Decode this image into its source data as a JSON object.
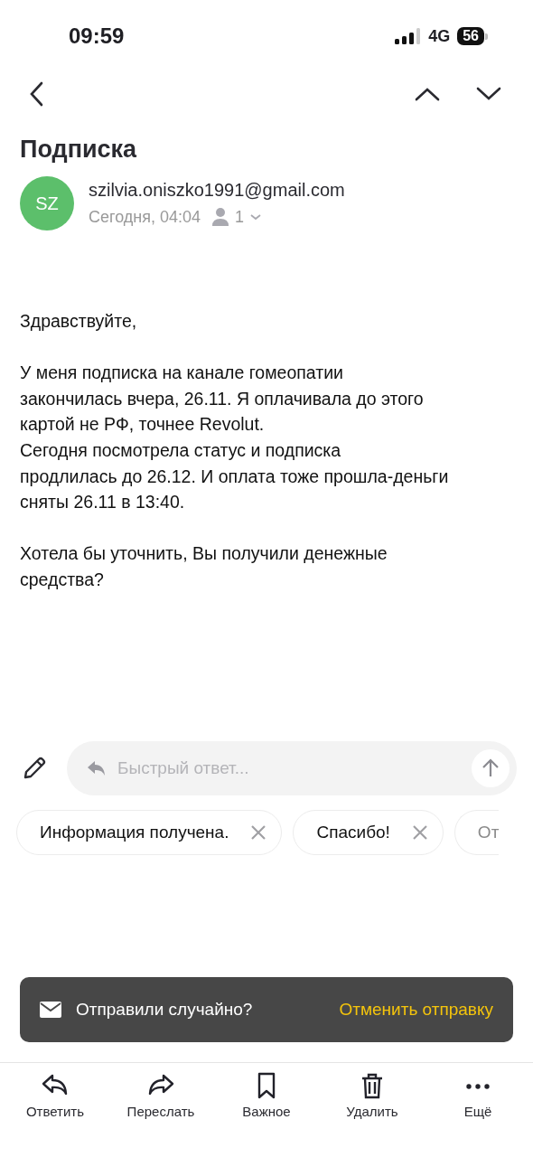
{
  "status_bar": {
    "time": "09:59",
    "network": "4G",
    "battery": "56"
  },
  "message": {
    "subject": "Подписка",
    "sender_initials": "SZ",
    "sender": "szilvia.oniszko1991@gmail.com",
    "date": "Сегодня, 04:04",
    "recipients_count": "1",
    "body": [
      [
        "Здравствуйте,"
      ],
      [
        "У меня подписка на канале гомеопатии",
        "закончилась вчера, 26.11. Я оплачивала до этого",
        "картой не РФ, точнее Revolut.",
        "Сегодня посмотрела статус и  подписка",
        "продлилась до 26.12. И оплата тоже прошла-деньги",
        "сняты 26.11 в 13:40."
      ],
      [
        "Хотела бы уточнить, Вы получили денежные",
        "средства?"
      ]
    ]
  },
  "quick_reply": {
    "placeholder": "Быстрый ответ..."
  },
  "suggestions": [
    {
      "label": "Информация получена."
    },
    {
      "label": "Спасибо!"
    },
    {
      "label": "От"
    }
  ],
  "toast": {
    "message": "Отправили случайно?",
    "action": "Отменить отправку"
  },
  "toolbar": [
    {
      "kind": "reply",
      "label": "Ответить"
    },
    {
      "kind": "forward",
      "label": "Переслать"
    },
    {
      "kind": "bookmark",
      "label": "Важное"
    },
    {
      "kind": "delete",
      "label": "Удалить"
    },
    {
      "kind": "more",
      "label": "Ещё"
    }
  ]
}
